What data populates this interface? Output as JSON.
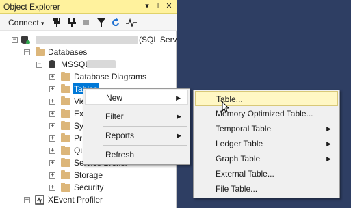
{
  "window": {
    "title": "Object Explorer",
    "pin_glyph": "▾",
    "autohide_glyph": "⊥",
    "close_glyph": "✕"
  },
  "toolbar": {
    "connect_label": "Connect",
    "connect_arrow": "▾"
  },
  "tree": {
    "server_suffix": "(SQL Serv",
    "databases_label": "Databases",
    "db_name": "MSSQL",
    "items": [
      {
        "label": "Database Diagrams"
      },
      {
        "label": "Tables"
      },
      {
        "label": "Vie"
      },
      {
        "label": "Ex"
      },
      {
        "label": "Sy"
      },
      {
        "label": "Pr"
      },
      {
        "label": "Qu"
      },
      {
        "label": "Service Broker"
      },
      {
        "label": "Storage"
      },
      {
        "label": "Security"
      }
    ],
    "xevent_label": "XEvent Profiler"
  },
  "context_menu": {
    "items": [
      {
        "label": "New",
        "arrow": "▶"
      },
      {
        "label": "Filter",
        "arrow": "▶"
      },
      {
        "label": "Reports",
        "arrow": "▶"
      },
      {
        "label": "Refresh"
      }
    ]
  },
  "submenu": {
    "items": [
      {
        "label": "Table...",
        "arrow": ""
      },
      {
        "label": "Memory Optimized Table...",
        "arrow": ""
      },
      {
        "label": "Temporal Table",
        "arrow": "▶"
      },
      {
        "label": "Ledger Table",
        "arrow": "▶"
      },
      {
        "label": "Graph Table",
        "arrow": "▶"
      },
      {
        "label": "External Table...",
        "arrow": ""
      },
      {
        "label": "File Table...",
        "arrow": ""
      }
    ]
  },
  "colors": {
    "title_bar": "#fff29d",
    "background_dark": "#2e3e63",
    "menu_selected": "#fff7c4"
  }
}
